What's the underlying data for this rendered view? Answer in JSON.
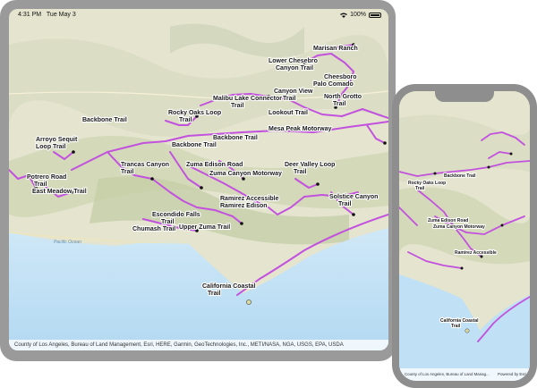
{
  "tablet": {
    "status": {
      "time": "4:31 PM",
      "date": "Tue May 3",
      "battery": "100%"
    },
    "attribution": "County of Los Angeles, Bureau of Land Management, Esri, HERE, Garmin, GeoTechnologies, Inc., METI/NASA, NGA, USGS, EPA, USDA",
    "ocean_label": "Pacific Ocean",
    "labels": [
      "Marisan Ranch",
      "Lower Chesebro",
      "Canyon Trail",
      "Cheesboro",
      "Palo Comado",
      "Malibu Lake Connector",
      "Trail",
      "Canyon View",
      "Trail",
      "Lookout Trail",
      "North Grotto",
      "Trail",
      "Rocky Oaks Loop",
      "Trail",
      "Backbone Trail",
      "Arroyo Sequit",
      "Loop Trail",
      "Mesa Peak Motorway",
      "Backbone Trail",
      "Backbone Trail",
      "Trancas Canyon",
      "Trail",
      "Zuma Edison Road",
      "Zuma Canyon Motorway",
      "Deer Valley Loop",
      "Trail",
      "Solstice Canyon",
      "Trail",
      "Potrero Road",
      "Trail",
      "East Meadow Trail",
      "Ramirez Accessible",
      "Ramirez Edison",
      "Escondido Falls",
      "Trail",
      "Chumash Trail",
      "California Coastal",
      "Trail",
      "Upper Zuma Trail"
    ]
  },
  "phone": {
    "attribution": "County of Los Angeles, Bureau of Land Manag...",
    "powered_by": "Powered by Esri",
    "labels": [
      "Rocky Oaks Loop",
      "Trail",
      "Backbone Trail",
      "Zuma Edison Road",
      "Zuma Canyon Motorway",
      "Ramirez Accessible",
      "California Coastal",
      "Trail"
    ]
  },
  "colors": {
    "trail": "#c251de",
    "land": "#e4e4cf",
    "ocean": "#bfe0f5"
  }
}
